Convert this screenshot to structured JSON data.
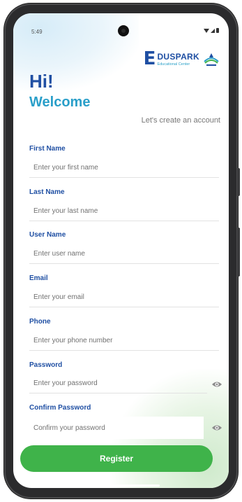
{
  "status_bar": {
    "time": "5:49"
  },
  "logo": {
    "letter": "E",
    "name": "DUSPARK",
    "sub": "Educational Center"
  },
  "header": {
    "greeting": "Hi!",
    "welcome": "Welcome",
    "subtitle": "Let's create an account"
  },
  "form": {
    "fields": [
      {
        "label": "First Name",
        "placeholder": "Enter your first name"
      },
      {
        "label": "Last Name",
        "placeholder": "Enter your last name"
      },
      {
        "label": "User Name",
        "placeholder": "Enter user name"
      },
      {
        "label": "Email",
        "placeholder": "Enter your email"
      },
      {
        "label": "Phone",
        "placeholder": "Enter your phone number"
      },
      {
        "label": "Password",
        "placeholder": "Enter your password"
      },
      {
        "label": "Confirm Password",
        "placeholder": "Confirm your password"
      }
    ],
    "register_label": "Register"
  },
  "colors": {
    "primary_blue": "#1f4fa3",
    "accent_cyan": "#2a9fc9",
    "button_green": "#3fb34a",
    "phone_frame": "#2b2b2d"
  },
  "icons": [
    "eye-icon",
    "wifi-icon",
    "signal-icon",
    "battery-icon",
    "camera-cutout"
  ]
}
